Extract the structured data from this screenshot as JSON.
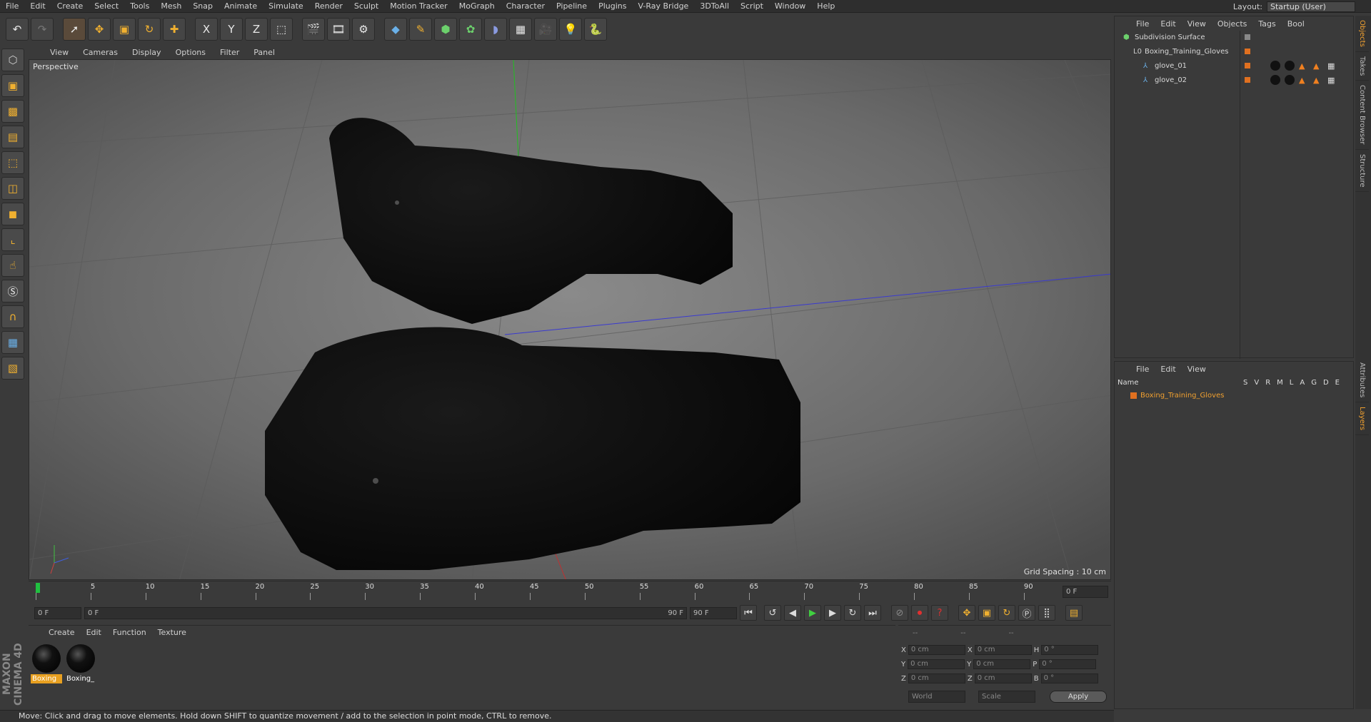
{
  "menu": [
    "File",
    "Edit",
    "Create",
    "Select",
    "Tools",
    "Mesh",
    "Snap",
    "Animate",
    "Simulate",
    "Render",
    "Sculpt",
    "Motion Tracker",
    "MoGraph",
    "Character",
    "Pipeline",
    "Plugins",
    "V-Ray Bridge",
    "3DToAll",
    "Script",
    "Window",
    "Help"
  ],
  "layout": {
    "label": "Layout:",
    "value": "Startup (User)"
  },
  "toolbar": {
    "x": "X",
    "y": "Y",
    "z": "Z"
  },
  "viewport": {
    "menu": [
      "View",
      "Cameras",
      "Display",
      "Options",
      "Filter",
      "Panel"
    ],
    "label": "Perspective",
    "grid_spacing": "Grid Spacing : 10 cm"
  },
  "timeline": {
    "ticks": [
      "0",
      "5",
      "10",
      "15",
      "20",
      "25",
      "30",
      "35",
      "40",
      "45",
      "50",
      "55",
      "60",
      "65",
      "70",
      "75",
      "80",
      "85",
      "90"
    ],
    "end_field": "0 F"
  },
  "playbar": {
    "start": "0 F",
    "range_start": "0 F",
    "range_end": "90 F",
    "end": "90 F"
  },
  "materials": {
    "menu": [
      "Create",
      "Edit",
      "Function",
      "Texture"
    ],
    "items": [
      {
        "label": "Boxing"
      },
      {
        "label": "Boxing_"
      }
    ]
  },
  "coords": {
    "header": [
      "--",
      "--",
      "--"
    ],
    "rows": [
      {
        "a": "X",
        "av": "0 cm",
        "b": "X",
        "bv": "0 cm",
        "c": "H",
        "cv": "0 °"
      },
      {
        "a": "Y",
        "av": "0 cm",
        "b": "Y",
        "bv": "0 cm",
        "c": "P",
        "cv": "0 °"
      },
      {
        "a": "Z",
        "av": "0 cm",
        "b": "Z",
        "bv": "0 cm",
        "c": "B",
        "cv": "0 °"
      }
    ],
    "mode1": "World",
    "mode2": "Scale",
    "apply": "Apply"
  },
  "objects": {
    "menu": [
      "File",
      "Edit",
      "View",
      "Objects",
      "Tags",
      "Bool"
    ],
    "items": [
      {
        "name": "Subdivision Surface",
        "indent": 0
      },
      {
        "name": "Boxing_Training_Gloves",
        "indent": 1
      },
      {
        "name": "glove_01",
        "indent": 2
      },
      {
        "name": "glove_02",
        "indent": 2
      }
    ]
  },
  "layers": {
    "menu": [
      "File",
      "Edit",
      "View"
    ],
    "col_name": "Name",
    "cols": [
      "S",
      "V",
      "R",
      "M",
      "L",
      "A",
      "G",
      "D",
      "E"
    ],
    "items": [
      {
        "name": "Boxing_Training_Gloves"
      }
    ]
  },
  "right_tabs": [
    "Objects",
    "Takes",
    "Content Browser",
    "Structure"
  ],
  "right_tabs_lower": [
    "Attributes",
    "Layers"
  ],
  "status": "Move: Click and drag to move elements. Hold down SHIFT to quantize movement / add to the selection in point mode, CTRL to remove.",
  "branding": "MAXON CINEMA 4D"
}
